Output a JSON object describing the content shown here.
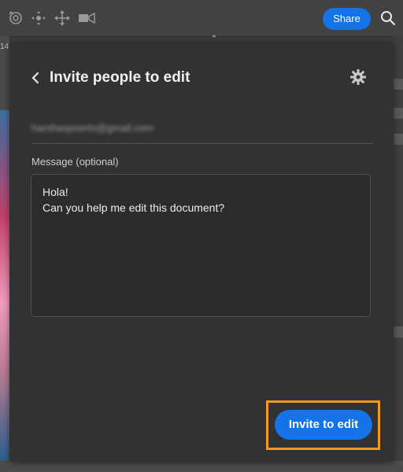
{
  "toolbar": {
    "icons": [
      "rotate-view-icon",
      "move-icon",
      "pan-arrows-icon",
      "video-icon"
    ],
    "share_label": "Share",
    "search_icon": "search-icon"
  },
  "background": {
    "left_tab_label": "14"
  },
  "dialog": {
    "title": "Invite people to edit",
    "email_value": "harshaspoerts@gmail.com",
    "message_label": "Message (optional)",
    "message_lines": [
      "Hola!",
      "Can you help me edit this document?"
    ],
    "invite_label": "Invite to edit"
  },
  "colors": {
    "accent": "#1473e6",
    "highlight": "#f29a1f",
    "panel": "#323232"
  }
}
